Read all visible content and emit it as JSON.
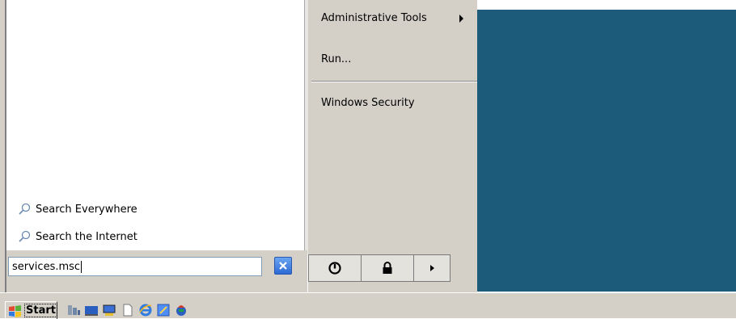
{
  "start_menu": {
    "left": {
      "search_links": [
        {
          "label": "Search Everywhere",
          "icon": "magnifier-icon"
        },
        {
          "label": "Search the Internet",
          "icon": "magnifier-icon"
        }
      ],
      "search_input": {
        "value": "services.msc",
        "clear_icon": "close-x-icon"
      }
    },
    "right": {
      "items": [
        {
          "label": "Administrative Tools",
          "has_submenu": true
        },
        {
          "label": "Run..."
        },
        {
          "label": "Windows Security"
        }
      ]
    },
    "power_buttons": [
      {
        "icon": "power-icon"
      },
      {
        "icon": "lock-icon"
      },
      {
        "icon": "arrow-right-icon"
      }
    ]
  },
  "taskbar": {
    "start_label": "Start",
    "quick_launch": [
      "server-manager-icon",
      "show-desktop-icon",
      "computer-icon",
      "document-icon",
      "internet-explorer-icon",
      "notepad-icon",
      "globe-icon"
    ]
  },
  "colors": {
    "desktop": "#1c5c7a",
    "menu_background": "#d4d0c8",
    "clear_button": "#2c6ad6"
  }
}
